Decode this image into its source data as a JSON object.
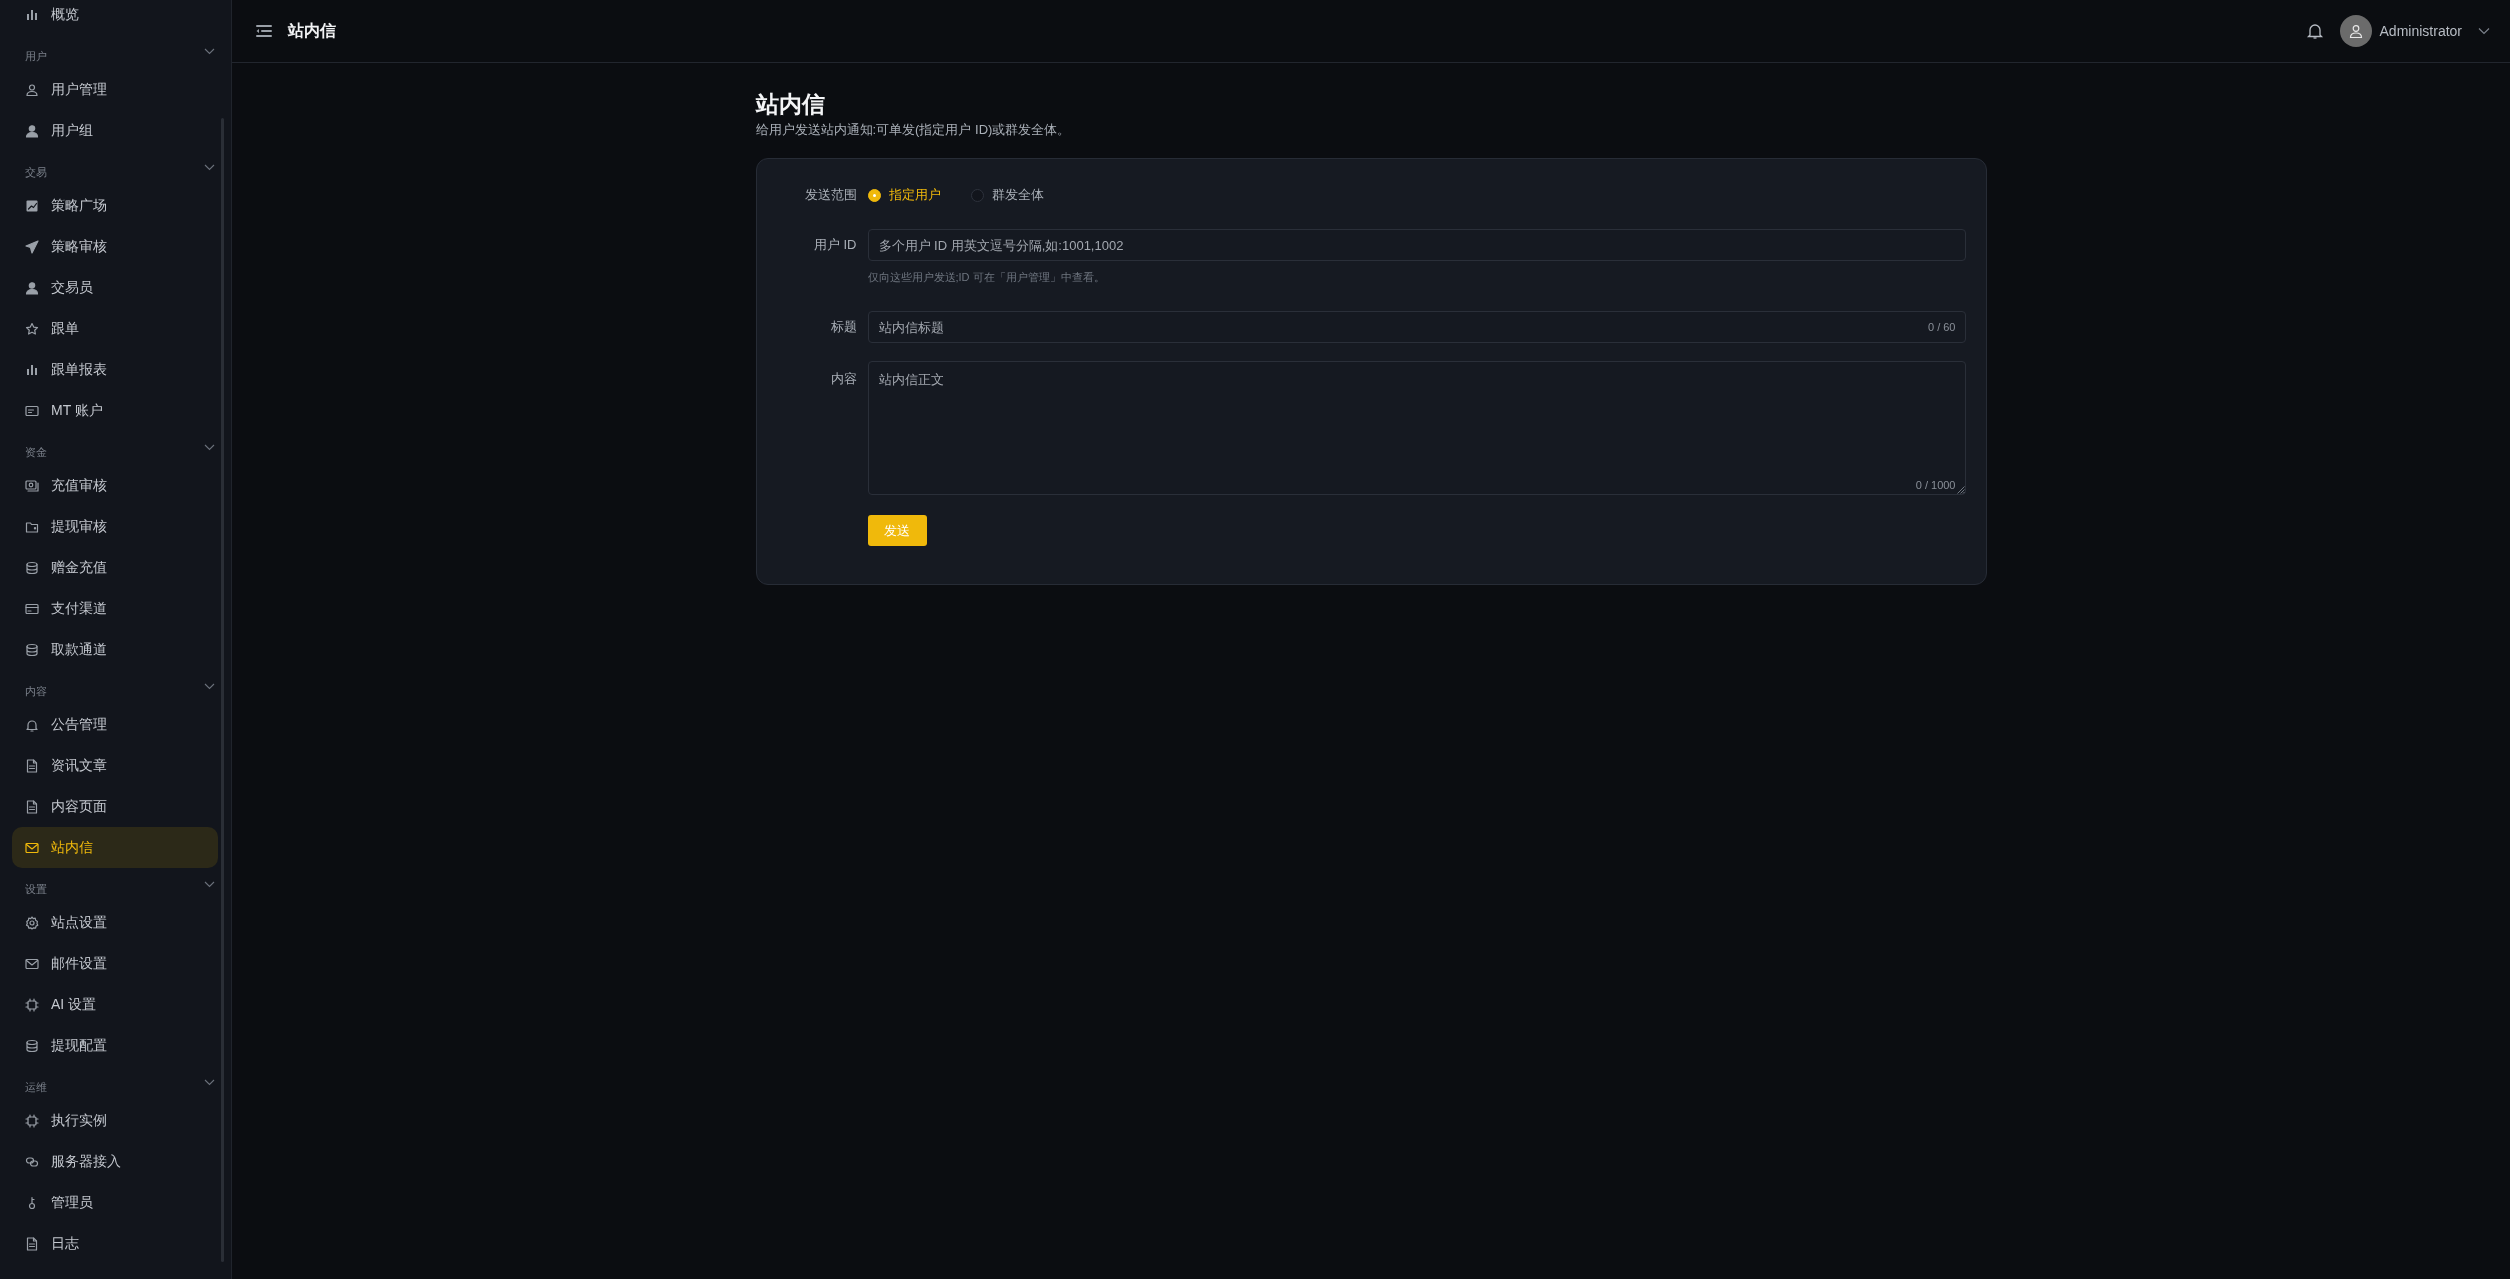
{
  "sidebar": {
    "sections": [
      {
        "items": [
          {
            "label": "概览",
            "selected": false
          }
        ]
      },
      {
        "title": "用户",
        "expanded": true,
        "items": [
          {
            "label": "用户管理",
            "selected": false
          },
          {
            "label": "用户组",
            "selected": false
          }
        ]
      },
      {
        "title": "交易",
        "expanded": true,
        "items": [
          {
            "label": "策略广场",
            "selected": false
          },
          {
            "label": "策略审核",
            "selected": false
          },
          {
            "label": "交易员",
            "selected": false
          },
          {
            "label": "跟单",
            "selected": false
          },
          {
            "label": "跟单报表",
            "selected": false
          },
          {
            "label": "MT 账户",
            "selected": false
          }
        ]
      },
      {
        "title": "资金",
        "expanded": true,
        "items": [
          {
            "label": "充值审核",
            "selected": false
          },
          {
            "label": "提现审核",
            "selected": false
          },
          {
            "label": "赠金充值",
            "selected": false
          },
          {
            "label": "支付渠道",
            "selected": false
          },
          {
            "label": "取款通道",
            "selected": false
          }
        ]
      },
      {
        "title": "内容",
        "expanded": true,
        "items": [
          {
            "label": "公告管理",
            "selected": false
          },
          {
            "label": "资讯文章",
            "selected": false
          },
          {
            "label": "内容页面",
            "selected": false
          },
          {
            "label": "站内信",
            "selected": true
          }
        ]
      },
      {
        "title": "设置",
        "expanded": true,
        "items": [
          {
            "label": "站点设置",
            "selected": false
          },
          {
            "label": "邮件设置",
            "selected": false
          },
          {
            "label": "AI 设置",
            "selected": false
          },
          {
            "label": "提现配置",
            "selected": false
          }
        ]
      },
      {
        "title": "运维",
        "expanded": true,
        "items": [
          {
            "label": "执行实例",
            "selected": false
          },
          {
            "label": "服务器接入",
            "selected": false
          },
          {
            "label": "管理员",
            "selected": false
          },
          {
            "label": "日志",
            "selected": false
          }
        ]
      }
    ]
  },
  "header": {
    "title": "站内信",
    "user": "Administrator"
  },
  "page": {
    "title": "站内信",
    "subtitle": "给用户发送站内通知:可单发(指定用户 ID)或群发全体。"
  },
  "form": {
    "scope": {
      "label": "发送范围",
      "options": [
        {
          "label": "指定用户",
          "selected": true
        },
        {
          "label": "群发全体",
          "selected": false
        }
      ]
    },
    "user_id": {
      "label": "用户 ID",
      "placeholder": "多个用户 ID 用英文逗号分隔,如:1001,1002",
      "help": "仅向这些用户发送;ID 可在「用户管理」中查看。"
    },
    "title": {
      "label": "标题",
      "placeholder": "站内信标题",
      "counter": "0 / 60"
    },
    "content": {
      "label": "内容",
      "placeholder": "站内信正文",
      "counter": "0 / 1000"
    },
    "submit": "发送"
  }
}
